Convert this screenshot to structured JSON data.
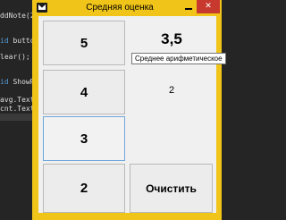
{
  "editor": {
    "lines": [
      {
        "pre": "",
        "kw": "",
        "text": "ddNote(2);"
      },
      {
        "pre": "",
        "kw": "id",
        "text": " button_"
      },
      {
        "pre": "",
        "kw": "",
        "text": "lear();"
      },
      {
        "pre": "",
        "kw": "id",
        "text": " ShowResu"
      },
      {
        "pre": "",
        "kw": "",
        "text": "avg.Text ="
      },
      {
        "pre": "",
        "kw": "",
        "text": "cnt.Text ="
      }
    ]
  },
  "window": {
    "title": "Средняя оценка",
    "close_glyph": "✕"
  },
  "grades": {
    "btn5": "5",
    "btn4": "4",
    "btn3": "3",
    "btn2": "2",
    "clear_label": "Очистить"
  },
  "result": {
    "average": "3,5",
    "count": "2",
    "tooltip": "Среднее арифметическое"
  },
  "colors": {
    "window_frame": "#f0c419",
    "close_button": "#c7392f",
    "editor_bg": "#252526"
  }
}
